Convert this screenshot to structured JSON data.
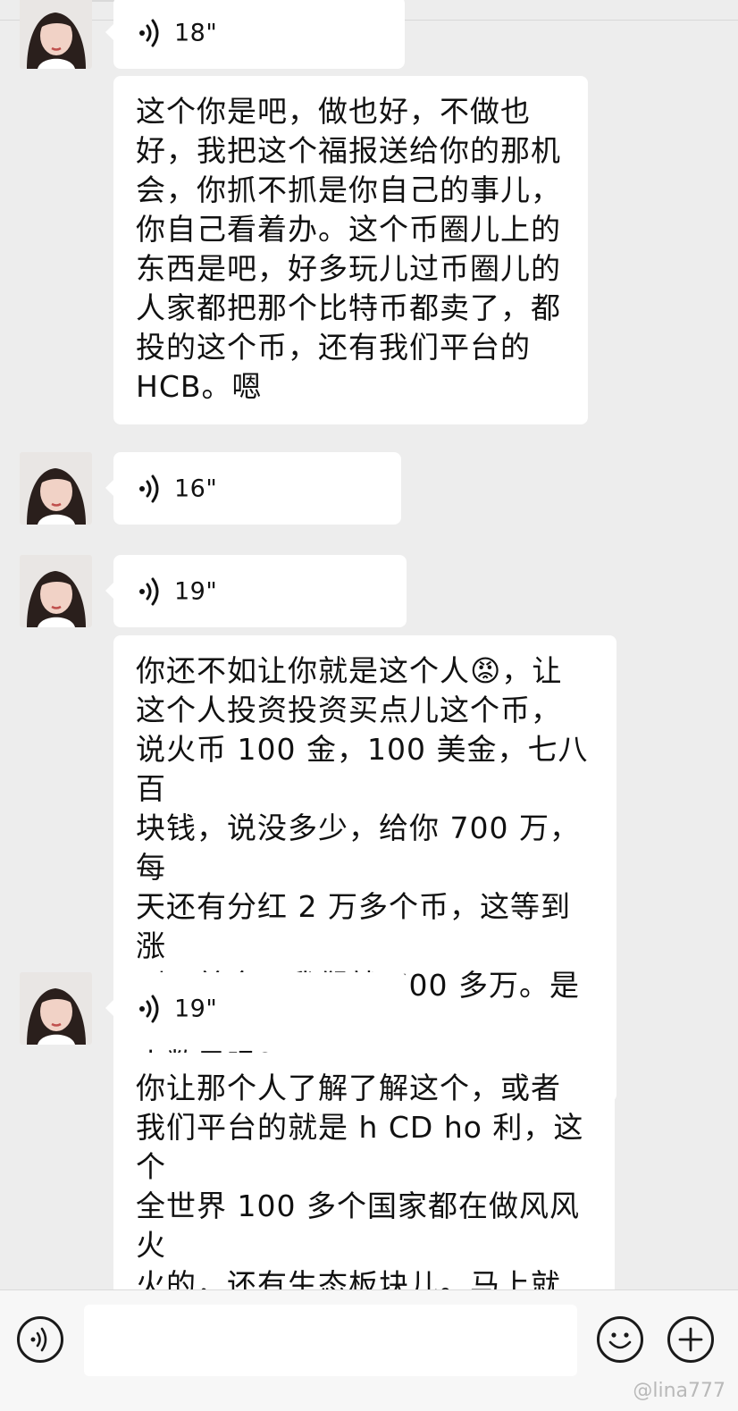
{
  "messages": [
    {
      "type": "voice",
      "duration": "18\""
    },
    {
      "type": "text",
      "text": "这个你是吧，做也好，不做也\n好，我把这个福报送给你的那机\n会，你抓不抓是你自己的事儿，\n你自己看着办。这个币圈儿上的\n东西是吧，好多玩儿过币圈儿的\n人家都把那个比特币都卖了，都\n投的这个币，还有我们平台的\nHCB。嗯"
    },
    {
      "type": "voice",
      "duration": "16\""
    },
    {
      "type": "voice",
      "duration": "19\""
    },
    {
      "type": "text",
      "text": "你还不如让你就是这个人😡，让\n这个人投资投资买点儿这个币，\n说火币 100 金，100 美金，七八百\n块钱，说没多少，给你 700 万，每\n天还有分红 2 万多个币，这等到涨\n到一美金，我们就 700 多万。是个\n小数目吗?"
    },
    {
      "type": "voice",
      "duration": "19\""
    },
    {
      "type": "text",
      "text": "你让那个人了解了解这个，或者\n我们平台的就是 h CD ho 利，这个\n全世界 100 多个国家都在做风风火\n火的，还有生态板块儿。马上就\n上二级市场，起飞了。"
    }
  ],
  "bottom_bar": {
    "voice_icon": "voice-input-icon",
    "emoji_icon": "smiley-icon",
    "plus_icon": "plus-icon",
    "input_value": ""
  },
  "watermark": "@lina777",
  "colors": {
    "background": "#ededed",
    "bubble": "#ffffff",
    "text": "#111111"
  }
}
